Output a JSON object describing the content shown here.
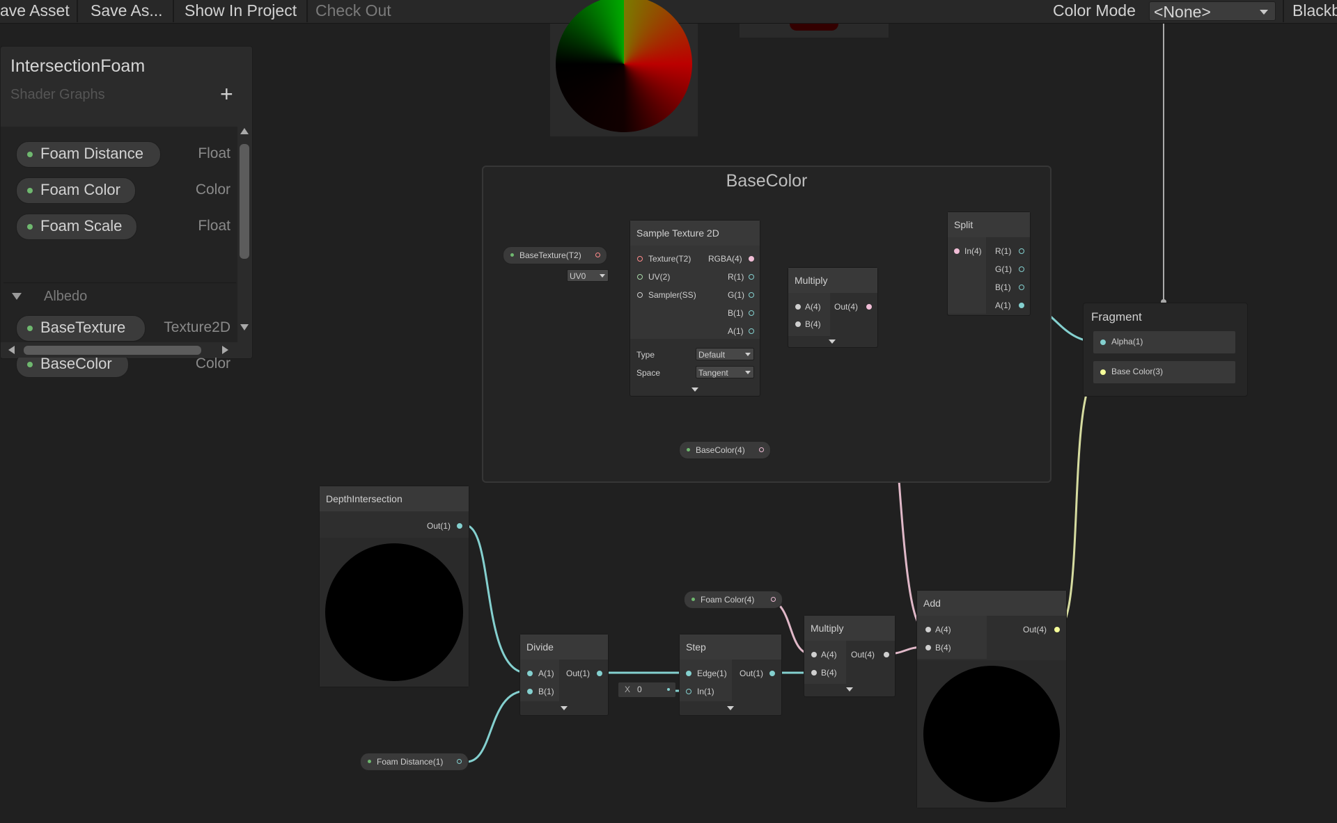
{
  "toolbar": {
    "save_asset": "ave Asset",
    "save_as": "Save As...",
    "show_in_project": "Show In Project",
    "check_out": "Check Out",
    "color_mode_label": "Color Mode",
    "color_mode_value": "<None>",
    "blackboard_toggle": "Blackb"
  },
  "blackboard": {
    "title": "IntersectionFoam",
    "subtitle": "Shader Graphs",
    "add_label": "+",
    "properties": [
      {
        "name": "Foam Distance",
        "type": "Float"
      },
      {
        "name": "Foam Color",
        "type": "Color"
      },
      {
        "name": "Foam Scale",
        "type": "Float"
      }
    ],
    "category": "Albedo",
    "category_properties": [
      {
        "name": "BaseTexture",
        "type": "Texture2D"
      },
      {
        "name": "BaseColor",
        "type": "Color"
      }
    ]
  },
  "group": {
    "title": "BaseColor"
  },
  "nodes": {
    "sample_texture": {
      "title": "Sample Texture 2D",
      "inputs": [
        "Texture(T2)",
        "UV(2)",
        "Sampler(SS)"
      ],
      "outputs": [
        "RGBA(4)",
        "R(1)",
        "G(1)",
        "B(1)",
        "A(1)"
      ],
      "type_label": "Type",
      "type_value": "Default",
      "space_label": "Space",
      "space_value": "Tangent"
    },
    "multiply_top": {
      "title": "Multiply",
      "inputs": [
        "A(4)",
        "B(4)"
      ],
      "output": "Out(4)"
    },
    "split": {
      "title": "Split",
      "input": "In(4)",
      "outputs": [
        "R(1)",
        "G(1)",
        "B(1)",
        "A(1)"
      ]
    },
    "fragment": {
      "title": "Fragment",
      "slots": [
        "Alpha(1)",
        "Base Color(3)"
      ]
    },
    "depth": {
      "title": "DepthIntersection",
      "output": "Out(1)"
    },
    "divide": {
      "title": "Divide",
      "inputs": [
        "A(1)",
        "B(1)"
      ],
      "output": "Out(1)"
    },
    "step": {
      "title": "Step",
      "inputs": [
        "Edge(1)",
        "In(1)"
      ],
      "output": "Out(1)",
      "inline_x_label": "X",
      "inline_x_value": "0"
    },
    "multiply_bottom": {
      "title": "Multiply",
      "inputs": [
        "A(4)",
        "B(4)"
      ],
      "output": "Out(4)"
    },
    "add": {
      "title": "Add",
      "inputs": [
        "A(4)",
        "B(4)"
      ],
      "output": "Out(4)"
    }
  },
  "pills": {
    "base_texture": "BaseTexture(T2)",
    "uv": "UV0",
    "base_color": "BaseColor(4)",
    "foam_color": "Foam Color(4)",
    "foam_distance": "Foam Distance(1)"
  },
  "colors": {
    "property_dot": "#6fb86f",
    "wire_float": "#84d0cf",
    "wire_vector": "#f0bdd6",
    "wire_texture": "#ff8b8b",
    "wire_color": "#f6ff9a"
  }
}
